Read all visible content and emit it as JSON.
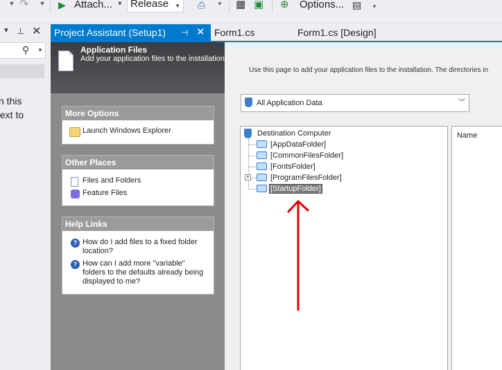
{
  "toolbar": {
    "attach_label": "Attach...",
    "config_value": "Release",
    "options_label": "Options..."
  },
  "left_panel": {
    "text_lines": [
      "n this",
      "text to"
    ]
  },
  "tabs": [
    {
      "label": "Project Assistant (Setup1)",
      "active": true
    },
    {
      "label": "Form1.cs",
      "active": false
    },
    {
      "label": "Form1.cs [Design]",
      "active": false
    }
  ],
  "assistant": {
    "title": "Application Files",
    "subtitle": "Add your application files to the installation.",
    "more_options": {
      "header": "More Options",
      "items": [
        {
          "label": "Launch Windows Explorer",
          "icon": "folder-icon"
        }
      ]
    },
    "other_places": {
      "header": "Other Places",
      "items": [
        {
          "label": "Files and Folders",
          "icon": "file-icon"
        },
        {
          "label": "Feature Files",
          "icon": "feature-icon"
        }
      ]
    },
    "help_links": {
      "header": "Help Links",
      "items": [
        {
          "label": "How do I add files to a fixed folder location?",
          "icon": "help-icon"
        },
        {
          "label": "How can I add more \"variable\" folders to the defaults already being displayed to me?",
          "icon": "help-icon"
        }
      ]
    }
  },
  "content": {
    "intro": "Use this page to add your application files to the installation. The directories in",
    "filter_value": "All Application Data",
    "tree": {
      "root": "Destination Computer",
      "folders": [
        {
          "label": "[AppDataFolder]",
          "expandable": false,
          "selected": false
        },
        {
          "label": "[CommonFilesFolder]",
          "expandable": false,
          "selected": false
        },
        {
          "label": "[FontsFolder]",
          "expandable": false,
          "selected": false
        },
        {
          "label": "[ProgramFilesFolder]",
          "expandable": true,
          "selected": false
        },
        {
          "label": "[StartupFolder]",
          "expandable": false,
          "selected": true
        }
      ]
    },
    "list_header": "Name"
  },
  "colors": {
    "accent": "#007acc",
    "annotation_arrow": "#e00000",
    "selected_node": "#7a7a7a"
  }
}
